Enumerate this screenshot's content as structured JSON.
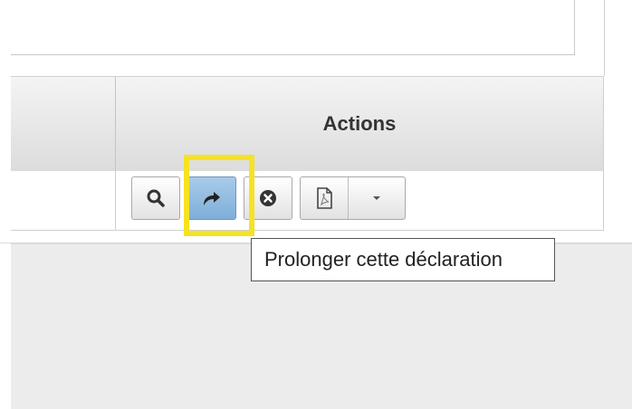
{
  "table": {
    "header_actions": "Actions"
  },
  "actions": {
    "view_icon": "magnifier-icon",
    "extend_icon": "redo-arrow-icon",
    "cancel_icon": "x-circle-icon",
    "pdf_icon": "pdf-document-icon",
    "dropdown_icon": "caret-down-icon"
  },
  "tooltip": {
    "text": "Prolonger cette déclaration"
  },
  "colors": {
    "highlight": "#f5e224",
    "active_button": "#8db8de"
  }
}
